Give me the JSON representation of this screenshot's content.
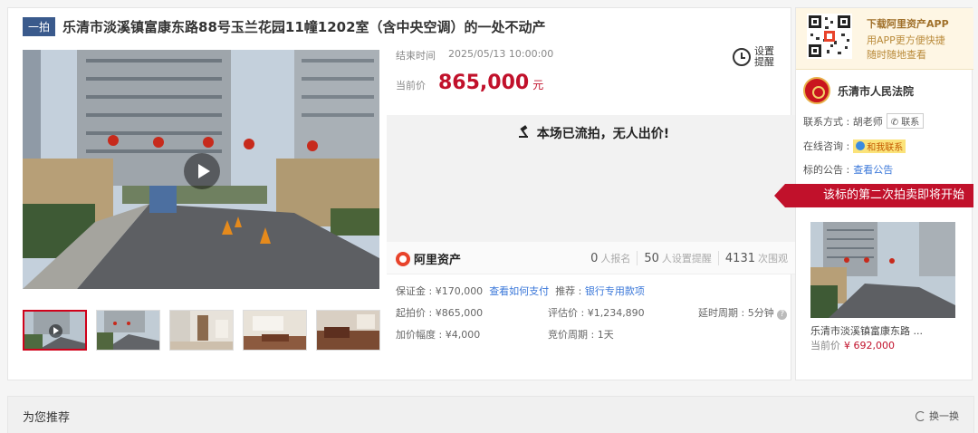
{
  "header": {
    "badge": "一拍",
    "title": "乐清市淡溪镇富康东路88号玉兰花园11幢1202室（含中央空调）的一处不动产"
  },
  "auction": {
    "end_label": "结束时间",
    "end_time": "2025/05/13 10:00:00",
    "price_label": "当前价",
    "price": "865,000",
    "price_unit": "元",
    "remind_label": "设置提醒",
    "status": "本场已流拍，无人出价!"
  },
  "platform": {
    "name": "阿里资产",
    "signups": "0",
    "signups_label": "人报名",
    "reminders": "50",
    "reminders_label": "人设置提醒",
    "views": "4131",
    "views_label": "次围观"
  },
  "details": {
    "deposit": "保证金 : ¥170,000",
    "how_to_pay": "查看如何支付",
    "recommend_label": "推荐 :",
    "bank_loan": "银行专用款项",
    "start_price": "起拍价 : ¥865,000",
    "appraisal": "评估价 : ¥1,234,890",
    "delay": "延时周期 : 5分钟",
    "increment": "加价幅度 : ¥4,000",
    "bid_period": "竞价周期 : 1天"
  },
  "side": {
    "app_title": "下载阿里资产APP",
    "app_line1": "用APP更方便快捷",
    "app_line2": "随时随地查看",
    "court": "乐清市人民法院",
    "contact_label": "联系方式 : 胡老师",
    "contact_btn": "联系",
    "online_label": "在线咨询 :",
    "chat_btn": "和我联系",
    "notice_label": "标的公告 :",
    "notice_link": "查看公告",
    "ribbon": "该标的第二次拍卖即将开始",
    "next_caption": "乐清市淡溪镇富康东路 ...",
    "next_price_label": "当前价",
    "next_price": "¥ 692,000"
  },
  "recommend": {
    "title": "为您推荐",
    "refresh": "换一换"
  }
}
